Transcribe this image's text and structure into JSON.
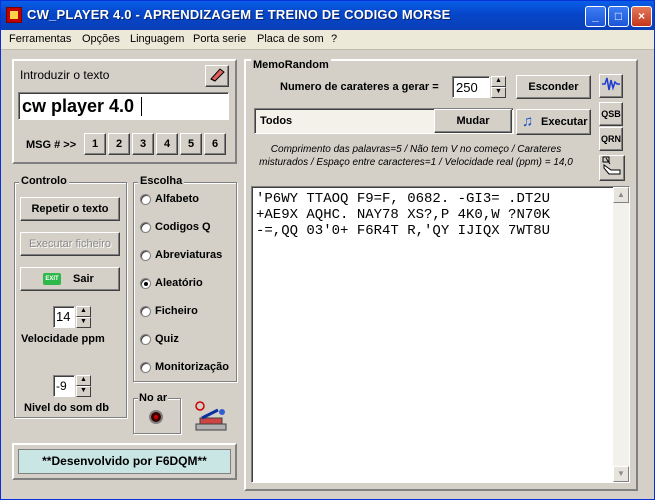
{
  "window": {
    "title": "CW_PLAYER 4.0 - APRENDIZAGEM E TREINO DE CODIGO MORSE",
    "minimize": "_",
    "maximize": "□",
    "close": "×"
  },
  "menu": [
    {
      "label": "Ferramentas"
    },
    {
      "label": "Opções"
    },
    {
      "label": "Linguagem"
    },
    {
      "label": "Porta serie"
    },
    {
      "label": "Placa de som"
    },
    {
      "label": "?"
    }
  ],
  "intro": {
    "label": "Introduzir o texto",
    "text_value": "cw player 4.0",
    "msg_label": "MSG # >>",
    "msg_buttons": [
      "1",
      "2",
      "3",
      "4",
      "5",
      "6"
    ]
  },
  "controlo": {
    "title": "Controlo",
    "repeat_label": "Repetir o texto",
    "run_file_label": "Executar ficheiro",
    "exit_icon_text": "EXIT",
    "exit_label": "Sair",
    "speed_value": "14",
    "speed_label": "Velocidade  ppm",
    "sound_value": "-9",
    "sound_label": "Nivel do som db"
  },
  "escolha": {
    "title": "Escolha",
    "options": [
      {
        "label": "Alfabeto",
        "selected": false
      },
      {
        "label": "Codigos Q",
        "selected": false
      },
      {
        "label": "Abreviaturas",
        "selected": false
      },
      {
        "label": "Aleatório",
        "selected": true
      },
      {
        "label": "Ficheiro",
        "selected": false
      },
      {
        "label": "Quiz",
        "selected": false
      },
      {
        "label": "Monitorização",
        "selected": false
      }
    ]
  },
  "noar": {
    "label": "No ar"
  },
  "footer": {
    "text": "**Desenvolvido por F6DQM**"
  },
  "memo": {
    "title": "MemoRandom",
    "count_label": "Numero de carateres a gerar =",
    "count_value": "250",
    "hide_label": "Esconder",
    "filter_value": "Todos",
    "change_label": "Mudar",
    "execute_label": "Executar",
    "qsb_label": "QSB",
    "qrn_label": "QRN",
    "info": "Comprimento das palavras=5 / Não tem V no começo / Carateres misturados / Espaço entre caracteres=1 / Velocidade real (ppm) = 14,0",
    "lines": [
      "'P6WY TTAOQ F9=F, 0682. -GI3= .DT2U",
      "+AE9X AQHC. NAY78 XS?,P 4K0,W ?N70K",
      "-=,QQ 03'0+ F6R4T R,'QY IJIQX 7WT8U"
    ]
  },
  "colors": {
    "titlebar": "#0a5ee8",
    "footer_bg": "#c9e6e4",
    "panel": "#d4d0c8"
  }
}
